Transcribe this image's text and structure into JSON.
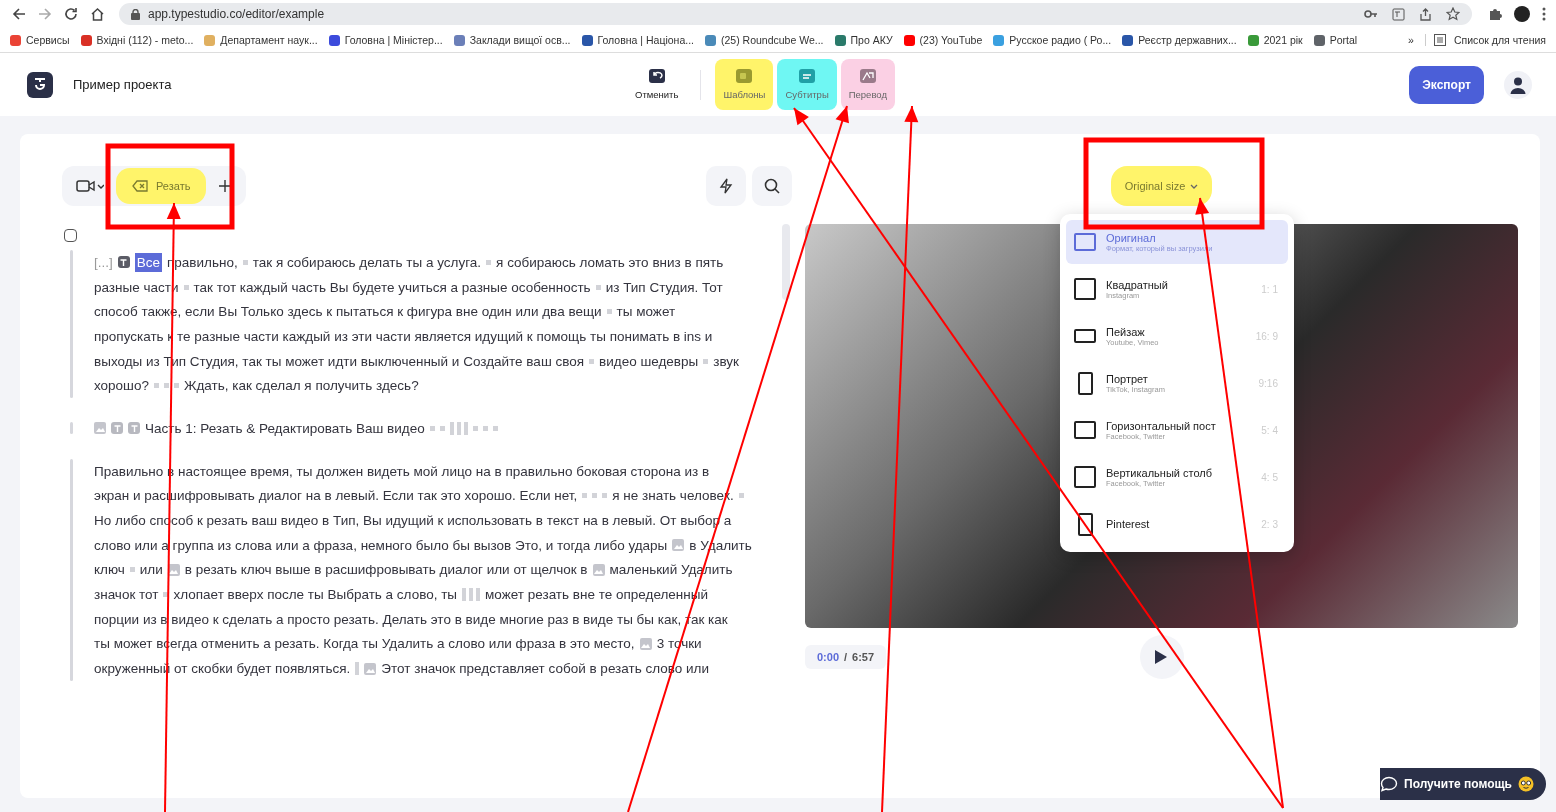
{
  "browser": {
    "url": "app.typestudio.co/editor/example",
    "bookmarks": [
      {
        "label": "Сервисы",
        "color": "#ea4335"
      },
      {
        "label": "Вхідні (112) - meto...",
        "color": "#d93025"
      },
      {
        "label": "Департамент наук...",
        "color": "#e0b060"
      },
      {
        "label": "Головна | Міністер...",
        "color": "#3c4bdc"
      },
      {
        "label": "Заклади вищої осв...",
        "color": "#6b7fb8"
      },
      {
        "label": "Головна | Націона...",
        "color": "#2a56a8"
      },
      {
        "label": "(25) Roundcube We...",
        "color": "#4a8ab8"
      },
      {
        "label": "Про АКУ",
        "color": "#2a7a6a"
      },
      {
        "label": "(23) YouTube",
        "color": "#ff0000"
      },
      {
        "label": "Русское радио ( Ро...",
        "color": "#3aa0e0"
      },
      {
        "label": "Реєстр державних...",
        "color": "#2a56a8"
      },
      {
        "label": "2021 рік",
        "color": "#3a9a3a"
      },
      {
        "label": "Portal",
        "color": "#5f6368"
      }
    ],
    "overflow": "»",
    "reading_list": "Список для чтения"
  },
  "header": {
    "project_title": "Пример проекта",
    "undo": "Отменить",
    "tools": [
      {
        "kind": "templates",
        "label": "Шаблоны",
        "color": "#fff46a"
      },
      {
        "kind": "subtitles",
        "label": "Субтитры",
        "color": "#6ff7f3"
      },
      {
        "kind": "translate",
        "label": "Перевод",
        "color": "#fbd0e4"
      }
    ],
    "export": "Экспорт"
  },
  "editor": {
    "cut_button": {
      "label": "Резать",
      "color": "#fff46a",
      "framed": true
    },
    "select_all": {
      "checked": false
    },
    "paragraphs": [
      {
        "kind": "body",
        "lines": [
          [
            {
              "kind": "ellipsis",
              "text": "[...]"
            },
            {
              "kind": "tag"
            },
            {
              "kind": "word",
              "text": "Все",
              "selected": true
            },
            {
              "kind": "text",
              "text": "правильно,"
            },
            {
              "kind": "pause"
            },
            {
              "kind": "text",
              "text": "так я собираюсь делать ты а услуга."
            },
            {
              "kind": "pause"
            },
            {
              "kind": "text",
              "text": "я собираюсь ломать это вниз в пять"
            }
          ],
          [
            {
              "kind": "text",
              "text": "разные части"
            },
            {
              "kind": "pause"
            },
            {
              "kind": "text",
              "text": "так тот каждый часть Вы будете учиться а разные особенность"
            },
            {
              "kind": "pause"
            },
            {
              "kind": "text",
              "text": "из Тип Студия. Тот"
            }
          ],
          [
            {
              "kind": "text",
              "text": "способ также, если Вы Только здесь к пытаться к фигура вне один или два вещи"
            },
            {
              "kind": "pause"
            },
            {
              "kind": "text",
              "text": "ты может"
            }
          ],
          [
            {
              "kind": "text",
              "text": "пропускать к те разные части каждый из эти части является идущий к помощь ты понимать в ins и"
            }
          ],
          [
            {
              "kind": "text",
              "text": "выходы из Тип Студия, так ты может идти выключенный и Создайте ваш своя"
            },
            {
              "kind": "pause"
            },
            {
              "kind": "text",
              "text": "видео шедевры"
            },
            {
              "kind": "pause"
            },
            {
              "kind": "text",
              "text": "звук"
            }
          ],
          [
            {
              "kind": "text",
              "text": "хорошо?"
            },
            {
              "kind": "pause"
            },
            {
              "kind": "pause"
            },
            {
              "kind": "pause"
            },
            {
              "kind": "text",
              "text": "Ждать, как сделал я получить здесь?"
            }
          ]
        ]
      },
      {
        "kind": "heading",
        "lines": [
          [
            {
              "kind": "image"
            },
            {
              "kind": "tag"
            },
            {
              "kind": "tag"
            },
            {
              "kind": "text",
              "text": "Часть 1: Резать & Редактировать Ваш видео"
            },
            {
              "kind": "pause"
            },
            {
              "kind": "pause"
            },
            {
              "kind": "bars"
            },
            {
              "kind": "pause"
            },
            {
              "kind": "pause"
            },
            {
              "kind": "pause"
            }
          ]
        ]
      },
      {
        "kind": "body",
        "lines": [
          [
            {
              "kind": "text",
              "text": "Правильно в настоящее время, ты должен видеть мой лицо на в правильно боковая сторона из в"
            }
          ],
          [
            {
              "kind": "text",
              "text": "экран и расшифровывать диалог на в левый. Если так это хорошо. Если нет,"
            },
            {
              "kind": "pause"
            },
            {
              "kind": "pause"
            },
            {
              "kind": "pause"
            },
            {
              "kind": "text",
              "text": "я не знать человек."
            },
            {
              "kind": "pause"
            }
          ],
          [
            {
              "kind": "text",
              "text": "Но либо способ к резать ваш видео в Тип, Вы идущий к использовать в текст на в левый. От выбор а"
            }
          ],
          [
            {
              "kind": "text",
              "text": "слово или а группа из слова или а фраза, немного было бы вызов Это, и тогда либо удары"
            },
            {
              "kind": "image"
            },
            {
              "kind": "text",
              "text": "в Удалить"
            }
          ],
          [
            {
              "kind": "text",
              "text": "ключ"
            },
            {
              "kind": "pause"
            },
            {
              "kind": "text",
              "text": "или"
            },
            {
              "kind": "image"
            },
            {
              "kind": "text",
              "text": "в резать ключ выше в расшифровывать диалог или от щелчок в"
            },
            {
              "kind": "image"
            },
            {
              "kind": "text",
              "text": "маленький Удалить"
            }
          ],
          [
            {
              "kind": "text",
              "text": "значок тот"
            },
            {
              "kind": "pause"
            },
            {
              "kind": "text",
              "text": "хлопает вверх после ты Выбрать а слово, ты"
            },
            {
              "kind": "bars"
            },
            {
              "kind": "text",
              "text": "может резать вне те определенный"
            }
          ],
          [
            {
              "kind": "text",
              "text": "порции из в видео к сделать а просто резать. Делать это в виде многие раз в виде ты бы как, так как"
            }
          ],
          [
            {
              "kind": "text",
              "text": "ты может всегда отменить а резать. Когда ты Удалить а слово или фраза в это место,"
            },
            {
              "kind": "image"
            },
            {
              "kind": "text",
              "text": "3 точки"
            }
          ],
          [
            {
              "kind": "text",
              "text": "окруженный от скобки будет появляться."
            },
            {
              "kind": "bar"
            },
            {
              "kind": "image"
            },
            {
              "kind": "text",
              "text": "Этот значок представляет собой в резать слово или"
            }
          ]
        ]
      }
    ]
  },
  "preview": {
    "size_button": {
      "label": "Original size",
      "color": "#fff46a",
      "framed": true
    },
    "size_menu": [
      {
        "kind": "wide",
        "label": "Оригинал",
        "sub": "Формат, который вы загрузили",
        "selected": true
      },
      {
        "kind": "square",
        "label": "Квадратный",
        "sub": "Instagram",
        "ratio": "1: 1",
        "selected": false
      },
      {
        "kind": "landscape",
        "label": "Пейзаж",
        "sub": "Youtube, Vimeo",
        "ratio": "16: 9",
        "selected": false
      },
      {
        "kind": "portrait",
        "label": "Портрет",
        "sub": "TikTok, Instagram",
        "ratio": "9:16",
        "selected": false
      },
      {
        "kind": "wide",
        "label": "Горизонтальный пост",
        "sub": "Facebook, Twitter",
        "ratio": "5: 4",
        "selected": false
      },
      {
        "kind": "square",
        "label": "Вертикальный столб",
        "sub": "Facebook, Twitter",
        "ratio": "4: 5",
        "selected": false
      },
      {
        "kind": "portrait",
        "label": "Pinterest",
        "ratio": "2: 3",
        "selected": false
      }
    ],
    "current_time": "0:00",
    "separator": "/",
    "duration": "6:57"
  },
  "help_button": "Получите помощь"
}
